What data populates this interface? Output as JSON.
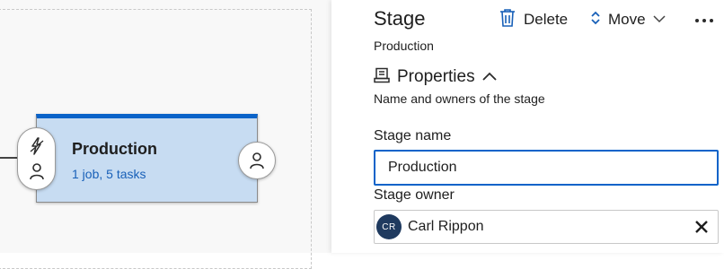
{
  "canvas": {
    "stage_card": {
      "title": "Production",
      "summary": "1 job, 5 tasks"
    },
    "icons": {
      "pre_trigger": "lightning-icon",
      "pre_approver": "person-icon",
      "post_approver": "person-icon"
    }
  },
  "panel": {
    "title": "Stage",
    "subtitle": "Production",
    "toolbar": {
      "delete_label": "Delete",
      "move_label": "Move",
      "delete_icon": "trash-icon",
      "move_icon": "up-down-chevron-icon",
      "more_icon": "ellipsis-icon"
    },
    "section": {
      "title": "Properties",
      "description": "Name and owners of the stage",
      "icon": "properties-icon",
      "expanded": true
    },
    "fields": {
      "stage_name_label": "Stage name",
      "stage_name_value": "Production",
      "stage_owner_label": "Stage owner",
      "owner_initials": "CR",
      "owner_name": "Carl Rippon"
    }
  },
  "colors": {
    "accent": "#0a63c9",
    "card_fill": "#c7dcf2",
    "link_text": "#1860b8",
    "avatar_bg": "#1f3a5f"
  }
}
